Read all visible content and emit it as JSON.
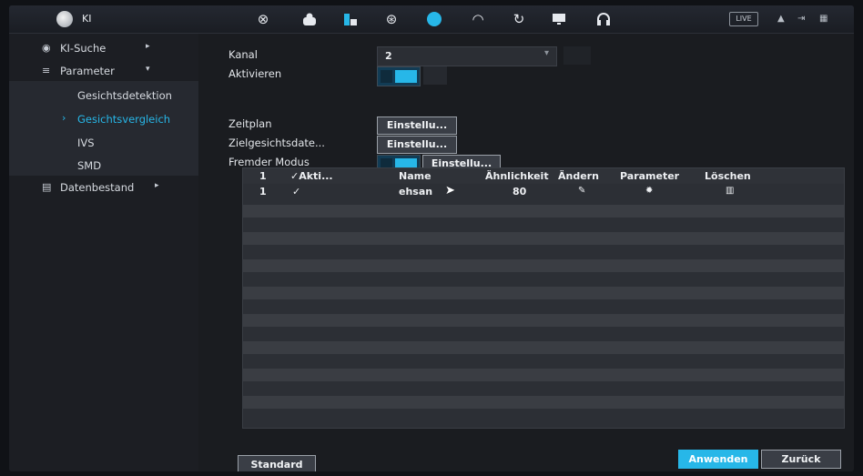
{
  "header": {
    "title": "KI",
    "icons": [
      "ai-search-icon",
      "person-icon",
      "building-icon",
      "globe-icon",
      "face-icon",
      "gauge-icon",
      "sync-icon",
      "monitor-icon",
      "headset-icon"
    ],
    "live_label": "LIVE",
    "right_icons": [
      "user-icon",
      "logout-icon",
      "grid-icon"
    ]
  },
  "sidebar": {
    "items": [
      {
        "label": "KI-Suche",
        "icon": "search-icon",
        "arrow": "▸"
      },
      {
        "label": "Parameter",
        "icon": "list-icon",
        "arrow": "▾"
      },
      {
        "label": "Gesichtsdetektion"
      },
      {
        "label": "Gesichtsvergleich",
        "selected": true,
        "marker": "›"
      },
      {
        "label": "IVS"
      },
      {
        "label": "SMD"
      },
      {
        "label": "Datenbestand",
        "icon": "database-icon",
        "arrow": "▸"
      }
    ]
  },
  "form": {
    "kanal_label": "Kanal",
    "kanal_value": "2",
    "aktivieren_label": "Aktivieren",
    "zeitplan_label": "Zeitplan",
    "zielgesicht_label": "Zielgesichtsdate...",
    "fremder_label": "Fremder Modus",
    "einstell_label": "Einstellu..."
  },
  "table": {
    "headers": [
      "1",
      "✓Akti...",
      "Name",
      "Ähnlichkeit",
      "Ändern",
      "Parameter",
      "Löschen"
    ],
    "rows": [
      {
        "index": "1",
        "active": "✓",
        "name": "ehsan",
        "similarity": "80"
      }
    ]
  },
  "footer": {
    "standard_label": "Standard",
    "apply_label": "Anwenden",
    "back_label": "Zurück"
  },
  "colors": {
    "accent": "#27b7e8",
    "background": "#1a1c20",
    "stripe": "#3a3d43"
  }
}
